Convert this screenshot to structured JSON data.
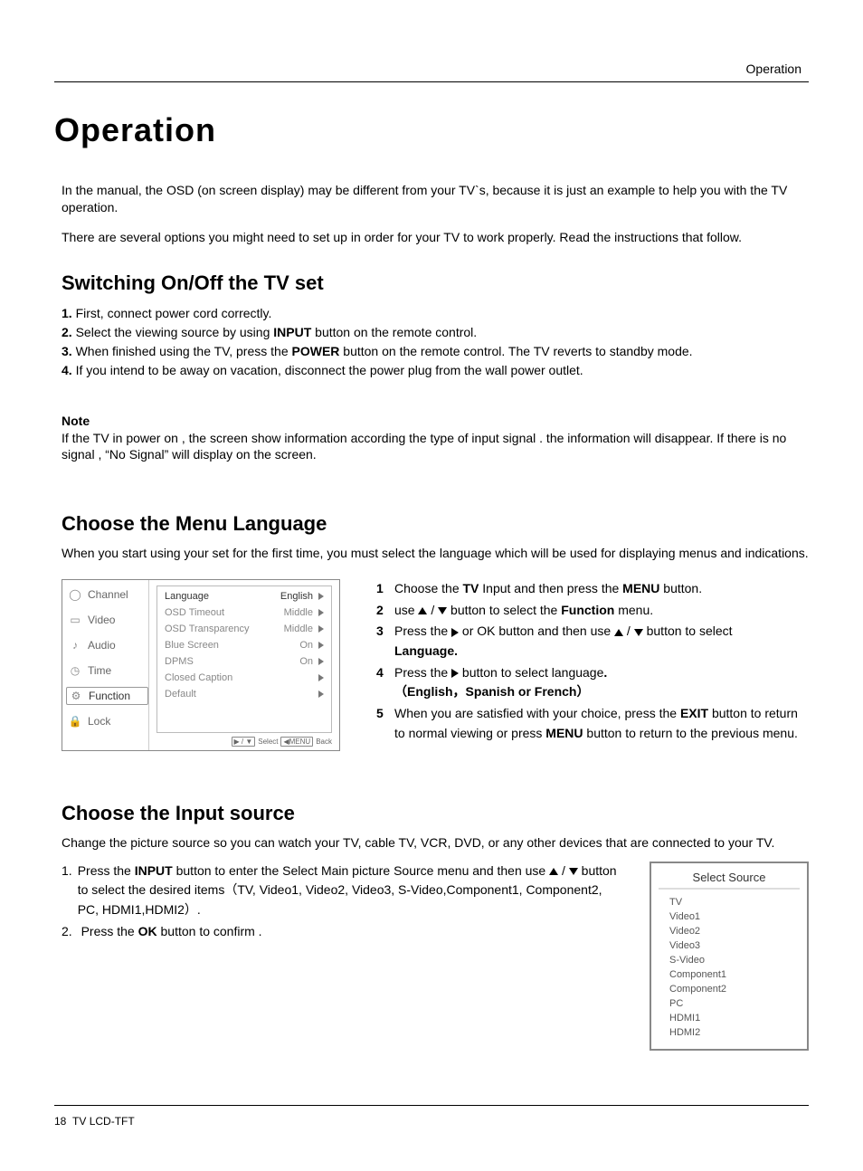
{
  "header_label": "Operation",
  "title": "Operation",
  "intro": {
    "p1": "In the manual, the OSD  (on screen display) may be different from your TV`s, because it is just an example to help you with the TV operation.",
    "p2": "There are several options you might need to set up in order for your TV to work properly. Read the instructions that follow."
  },
  "switching": {
    "heading": "Switching On/Off the TV set",
    "s1_pre": "1. ",
    "s1": "First, connect power cord correctly.",
    "s2_pre": "2. ",
    "s2_a": "Select the viewing source by using ",
    "s2_b": "INPUT",
    "s2_c": " button on the remote control.",
    "s3_pre": "3. ",
    "s3_a": "When finished using the TV, press the ",
    "s3_b": "POWER",
    "s3_c": " button on the remote control. The TV reverts to standby mode.",
    "s4_pre": "4. ",
    "s4": "If you intend to be away on vacation, disconnect the power plug from the wall power outlet."
  },
  "note": {
    "heading": "Note",
    "body": "If the TV in power on , the screen show information according the type of input signal . the information will disappear. If there is no signal , “No Signal” will display on the screen."
  },
  "lang": {
    "heading": "Choose the Menu Language",
    "desc": "When you start using your set for the first time, you must select the language which will be used for displaying menus and indications.",
    "tabs": [
      "Channel",
      "Video",
      "Audio",
      "Time",
      "Function",
      "Lock"
    ],
    "active_tab_index": 4,
    "options": [
      {
        "label": "Language",
        "value": "English",
        "arrow": true
      },
      {
        "label": "OSD Timeout",
        "value": "Middle",
        "arrow": true
      },
      {
        "label": "OSD Transparency",
        "value": "Middle",
        "arrow": true
      },
      {
        "label": "Blue Screen",
        "value": "On",
        "arrow": true
      },
      {
        "label": "DPMS",
        "value": "On",
        "arrow": true
      },
      {
        "label": "Closed Caption",
        "value": "",
        "arrow": true
      },
      {
        "label": "Default",
        "value": "",
        "arrow": true
      }
    ],
    "footer_select": "Select",
    "footer_back": "Back",
    "instr": {
      "i1_a": "Choose the ",
      "i1_b": "TV",
      "i1_c": " Input and then press the ",
      "i1_d": "MENU",
      "i1_e": " button.",
      "i2_a": "use ",
      "i2_b": " button to select the ",
      "i2_c": "Function",
      "i2_d": " menu.",
      "i3_a": "Press the ",
      "i3_b": " or OK button and then use ",
      "i3_c": " button to select ",
      "i3_d": "Language.",
      "i4_a": "Press the ",
      "i4_b": " button  to select  language",
      "i4_c": ".",
      "i4_langs": "（English，Spanish or French）",
      "i5_a": "When you are satisfied with your choice, press the ",
      "i5_b": "EXIT",
      "i5_c": " button to return to normal viewing or press ",
      "i5_d": "MENU",
      "i5_e": " button to return to the previous menu."
    }
  },
  "input": {
    "heading": "Choose the Input source",
    "desc": "Change the picture source so you can watch your TV, cable TV, VCR, DVD, or any other devices that are connected to your TV.",
    "s1_a": "Press the ",
    "s1_b": "INPUT",
    "s1_c": " button to enter the Select Main picture Source menu and then use ",
    "s1_d": " button to select the desired items（TV, Video1, Video2, Video3, S-Video,Component1, Component2, PC, HDMI1,HDMI2）.",
    "s2_a": "Press the ",
    "s2_b": "OK",
    "s2_c": " button to confirm .",
    "box_title": "Select Source",
    "sources": [
      "TV",
      "Video1",
      "Video2",
      "Video3",
      "S-Video",
      "Component1",
      "Component2",
      "PC",
      "HDMI1",
      "HDMI2"
    ]
  },
  "footer": {
    "page": "18",
    "label": "TV LCD-TFT"
  }
}
